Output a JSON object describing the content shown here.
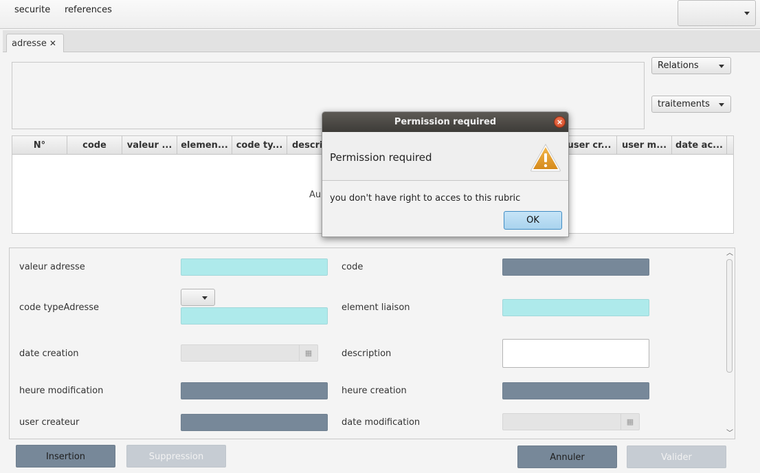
{
  "menubar": {
    "items": [
      "securite",
      "references"
    ],
    "combo_value": ""
  },
  "tabs": [
    {
      "label": "adresse",
      "close_glyph": "✕"
    }
  ],
  "side_buttons": {
    "relations": "Relations",
    "traitements": "traitements"
  },
  "table": {
    "columns": [
      "N°",
      "code",
      "valeur ...",
      "elemen...",
      "code ty...",
      "descri",
      "user cr...",
      "user m...",
      "date ac..."
    ],
    "empty_text": "Au"
  },
  "form": {
    "valeur_adresse": {
      "label": "valeur adresse",
      "value": ""
    },
    "code": {
      "label": "code",
      "value": ""
    },
    "code_type_adresse": {
      "label": "code typeAdresse",
      "value": ""
    },
    "element_liaison": {
      "label": "element liaison",
      "value": ""
    },
    "date_creation": {
      "label": "date creation",
      "value": ""
    },
    "description": {
      "label": "description",
      "value": ""
    },
    "heure_modification": {
      "label": "heure modification",
      "value": ""
    },
    "heure_creation": {
      "label": "heure creation",
      "value": ""
    },
    "user_createur": {
      "label": "user createur",
      "value": ""
    },
    "date_modification": {
      "label": "date modification",
      "value": ""
    }
  },
  "actions": {
    "insertion": "Insertion",
    "suppression": "Suppression",
    "annuler": "Annuler",
    "valider": "Valider"
  },
  "dialog": {
    "title": "Permission required",
    "heading": "Permission required",
    "message": "you don't have right to acces to this rubric",
    "ok_label": "OK",
    "close_glyph": "×",
    "icon": "warning-icon"
  },
  "colors": {
    "required_field": "#aeeaeb",
    "readonly_field": "#778899",
    "dialog_title_bar": "#3d3b38",
    "warning_icon": "#e09b2d"
  }
}
